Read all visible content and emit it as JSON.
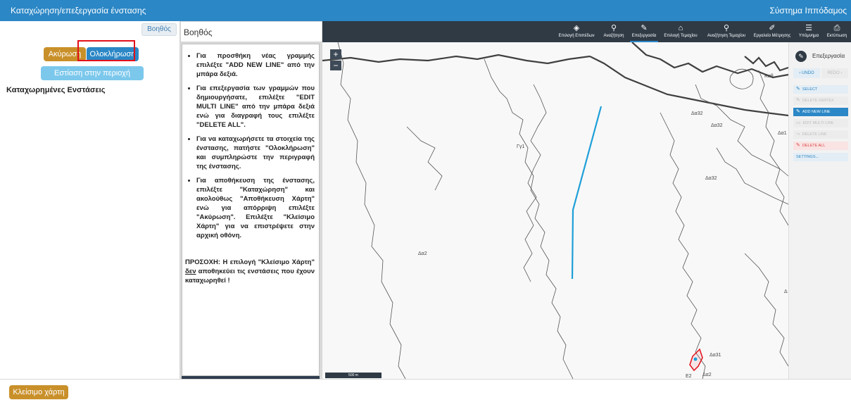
{
  "titlebar": {
    "title": "Καταχώρηση/επεξεργασία ένστασης",
    "app_name": "Σύστημα Ιππόδαμος"
  },
  "left_panel": {
    "help_button": "Βοηθός",
    "cancel_button": "Ακύρωση",
    "complete_button": "Ολοκλήρωση",
    "focus_button": "Εστίαση στην περιοχή μελέτης",
    "registered_title": "Καταχωρημένες Ενστάσεις",
    "colors": {
      "cancel": "#c9902a",
      "complete": "#2b87c6",
      "focus": "#7cc8ec",
      "highlight": "#e3101a"
    }
  },
  "help_panel": {
    "title": "Βοηθός",
    "items": [
      "Για προσθήκη νέας γραμμής επιλέξτε \"ADD NEW LINE\" από την μπάρα δεξιά.",
      "Για επεξεργασία των γραμμών που δημιουργήσατε, επιλέξτε \"EDIT MULTI LINE\" από την μπάρα δεξιά ενώ για διαγραφή τους επιλέξτε \"DELETE ALL\".",
      "Για να καταχωρήσετε τα στοιχεία της ένστασης, πατήστε \"Ολοκλήρωση\" και συμπληρώστε την περιγραφή της ένστασης.",
      "Για αποθήκευση της ένστασης, επιλέξτε \"Καταχώρηση\" και ακολούθως \"Αποθήκευση Χάρτη\" ενώ για απόρριψη επιλέξτε \"Ακύρωση\". Επιλέξτε \"Κλείσιμο Χάρτη\" για να επιστρέψετε στην αρχική οθόνη."
    ],
    "warning_prefix": "ΠΡΟΣΟΧΗ: Η επιλογή \"Κλείσιμο Χάρτη\" ",
    "warning_emph": "δεν",
    "warning_suffix": " αποθηκεύει τις ενστάσεις που έχουν καταχωρηθεί !"
  },
  "map_toolbar": [
    {
      "icon": "layers-icon",
      "glyph": "◈",
      "label": "Επιλογή Επιπέδων"
    },
    {
      "icon": "search-icon",
      "glyph": "⚲",
      "label": "Αναζήτηση"
    },
    {
      "icon": "pencil-icon",
      "glyph": "✎",
      "label": "Επεξεργασία",
      "active": true
    },
    {
      "icon": "parcel-select-icon",
      "glyph": "⌂",
      "label": "Επιλογή Τεμαχίου"
    },
    {
      "icon": "parcel-search-icon",
      "glyph": "⚲",
      "label": "Αναζήτηση Τεμαχίου"
    },
    {
      "icon": "ruler-icon",
      "glyph": "✐",
      "label": "Εργαλείο Μέτρησης"
    },
    {
      "icon": "legend-icon",
      "glyph": "☰",
      "label": "Υπόμνημα"
    },
    {
      "icon": "print-icon",
      "glyph": "⎙",
      "label": "Εκτύπωση"
    }
  ],
  "map": {
    "zoom_in": "+",
    "zoom_out": "−",
    "scale": "500 m",
    "labels": [
      "Kαθ",
      "Δα32",
      "Δα32",
      "Δα1",
      "Γγ1",
      "Δα32",
      "Δα2",
      "Δα31",
      "Ε2",
      "Δα2",
      "Δ"
    ],
    "colors": {
      "drawn_line": "#1e9fd8",
      "selected_parcel": "#e3101a",
      "boundary": "#555555",
      "thick_boundary": "#404040"
    }
  },
  "edit_panel": {
    "title": "Επεξεργασία",
    "undo": "UNDO",
    "redo": "REDO",
    "buttons": [
      {
        "label": "SELECT",
        "glyph": "✎",
        "state": "normal"
      },
      {
        "label": "DELETE VERTEX",
        "glyph": "✎",
        "state": "disabled"
      },
      {
        "label": "ADD NEW LINE",
        "glyph": "✎",
        "state": "active"
      },
      {
        "label": "EDIT MULTI LINE",
        "glyph": "▭",
        "state": "disabled"
      },
      {
        "label": "DELETE LINE",
        "glyph": "⤳",
        "state": "disabled"
      },
      {
        "label": "DELETE ALL",
        "glyph": "✎",
        "state": "danger"
      },
      {
        "label": "SETTINGS...",
        "glyph": "",
        "state": "normal"
      }
    ]
  },
  "footer": {
    "close_map_button": "Κλείσιμο χάρτη"
  }
}
